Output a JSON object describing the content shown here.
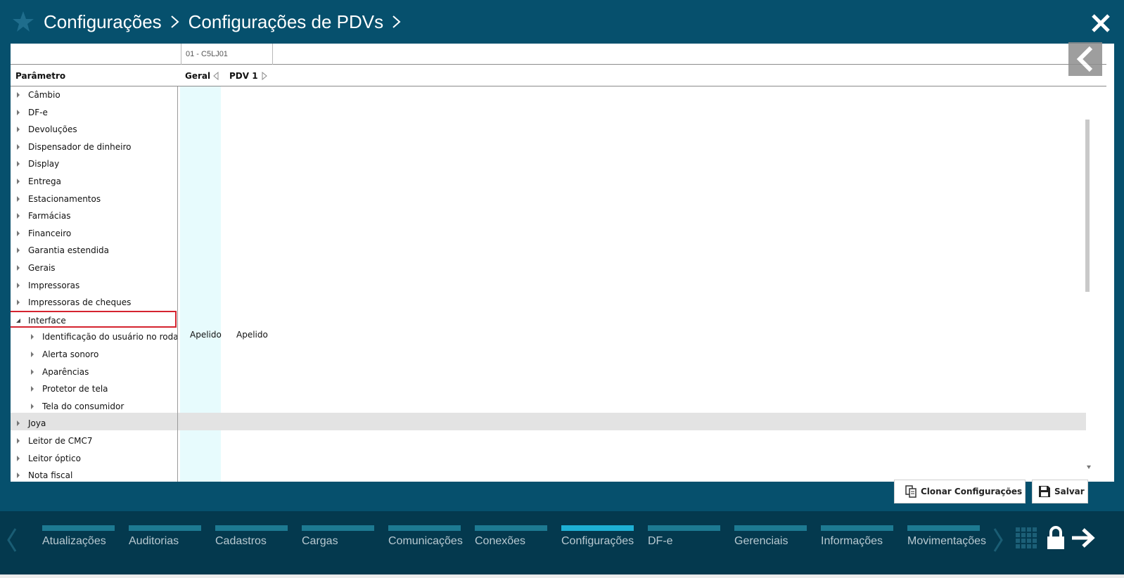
{
  "header": {
    "breadcrumb": [
      "Configurações",
      "Configurações de PDVs"
    ],
    "star_icon": "star-icon",
    "close_icon": "close-icon"
  },
  "grid": {
    "store": "01 - C5LJ01",
    "column_param": "Parâmetro",
    "column_geral": "Geral",
    "column_pdv": "PDV 1",
    "cell_geral": "Apelido",
    "cell_pdv": "Apelido"
  },
  "tree": [
    {
      "label": "Câmbio",
      "level": 1
    },
    {
      "label": "DF-e",
      "level": 1
    },
    {
      "label": "Devoluções",
      "level": 1
    },
    {
      "label": "Dispensador de dinheiro",
      "level": 1
    },
    {
      "label": "Display",
      "level": 1
    },
    {
      "label": "Entrega",
      "level": 1
    },
    {
      "label": "Estacionamentos",
      "level": 1
    },
    {
      "label": "Farmácias",
      "level": 1
    },
    {
      "label": "Financeiro",
      "level": 1
    },
    {
      "label": "Garantia estendida",
      "level": 1
    },
    {
      "label": "Gerais",
      "level": 1
    },
    {
      "label": "Impressoras",
      "level": 1
    },
    {
      "label": "Impressoras de cheques",
      "level": 1
    },
    {
      "label": "Interface",
      "level": 1,
      "expanded": true,
      "selected": true
    },
    {
      "label": "Identificação do usuário no rodapé",
      "level": 2
    },
    {
      "label": "Alerta sonoro",
      "level": 2
    },
    {
      "label": "Aparências",
      "level": 2
    },
    {
      "label": "Protetor de tela",
      "level": 2
    },
    {
      "label": "Tela do consumidor",
      "level": 2
    },
    {
      "label": "Joya",
      "level": 1
    },
    {
      "label": "Leitor de CMC7",
      "level": 1
    },
    {
      "label": "Leitor óptico",
      "level": 1
    },
    {
      "label": "Nota fiscal",
      "level": 1
    }
  ],
  "actions": {
    "clone_label": "Clonar Configurações",
    "save_label": "Salvar"
  },
  "bottom_nav": [
    {
      "label": "Atualizações"
    },
    {
      "label": "Auditorias"
    },
    {
      "label": "Cadastros"
    },
    {
      "label": "Cargas"
    },
    {
      "label": "Comunicações"
    },
    {
      "label": "Conexões"
    },
    {
      "label": "Configurações",
      "active": true
    },
    {
      "label": "DF-e"
    },
    {
      "label": "Gerenciais"
    },
    {
      "label": "Informações"
    },
    {
      "label": "Movimentações"
    }
  ],
  "colors": {
    "header_bg": "#06506d",
    "bottom_bg": "#04394e",
    "nav_bar": "#1d7a92",
    "nav_bar_active": "#1eb0d4",
    "selection_border": "#d5232f",
    "geral_column_bg": "#e7fbfd"
  }
}
